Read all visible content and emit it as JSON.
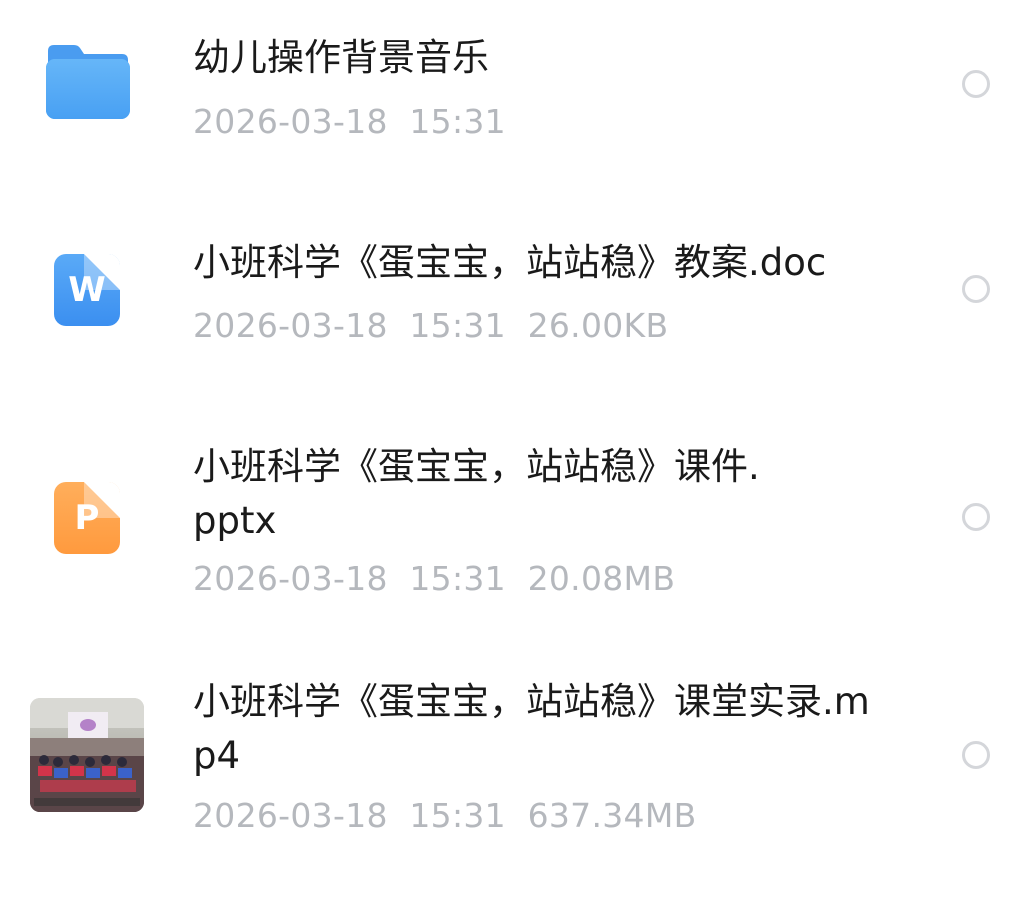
{
  "files": [
    {
      "icon": "folder-icon",
      "name": "幼儿操作背景音乐",
      "date": "2026-03-18",
      "time": "15:31",
      "size": ""
    },
    {
      "icon": "word-doc-icon",
      "name": "小班科学《蛋宝宝，站站稳》教案.doc",
      "date": "2026-03-18",
      "time": "15:31",
      "size": "26.00KB"
    },
    {
      "icon": "ppt-icon",
      "name": "小班科学《蛋宝宝，站站稳》课件.pptx",
      "date": "2026-03-18",
      "time": "15:31",
      "size": "20.08MB"
    },
    {
      "icon": "video-thumbnail",
      "name": "小班科学《蛋宝宝，站站稳》课堂实录.mp4",
      "date": "2026-03-18",
      "time": "15:31",
      "size": "637.34MB"
    }
  ],
  "colors": {
    "folder": "#4a9cf0",
    "word": "#3b8ff0",
    "ppt": "#ff9a3e",
    "meta_text": "#b5b8bd",
    "radio_border": "#d4d6da"
  }
}
